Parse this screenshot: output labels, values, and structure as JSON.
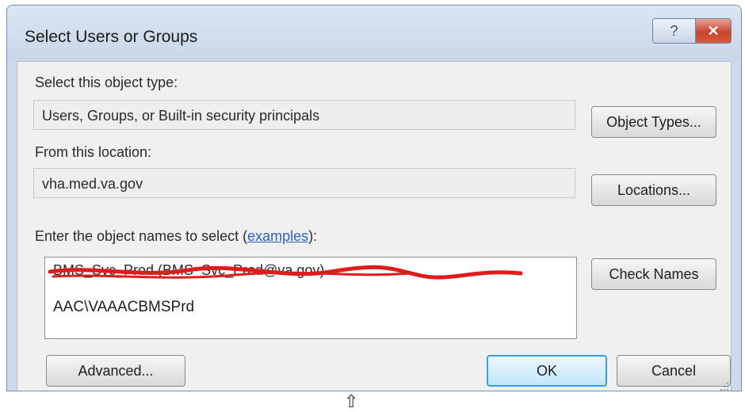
{
  "window": {
    "title": "Select Users or Groups",
    "help_glyph": "?",
    "close_glyph": "✕"
  },
  "object_type": {
    "label": "Select this object type:",
    "value": "Users, Groups, or Built-in security principals",
    "button": "Object Types..."
  },
  "location": {
    "label": "From this location:",
    "value": "vha.med.va.gov",
    "button": "Locations..."
  },
  "names": {
    "label_prefix": "Enter the object names to select (",
    "label_link": "examples",
    "label_suffix": "):",
    "entry_redacted": "BMS_Svc_Prod (BMS_Svc_Prod@va.gov)",
    "entry_plain": "AAC\\VAAACBMSPrd",
    "check_button": "Check Names"
  },
  "footer": {
    "advanced_button": "Advanced...",
    "ok_button": "OK",
    "cancel_button": "Cancel"
  },
  "cursor_glyph": "⇧",
  "colors": {
    "redaction": "#e01b1b",
    "default_button_border": "#3d9be0",
    "link": "#2c5fbf"
  }
}
